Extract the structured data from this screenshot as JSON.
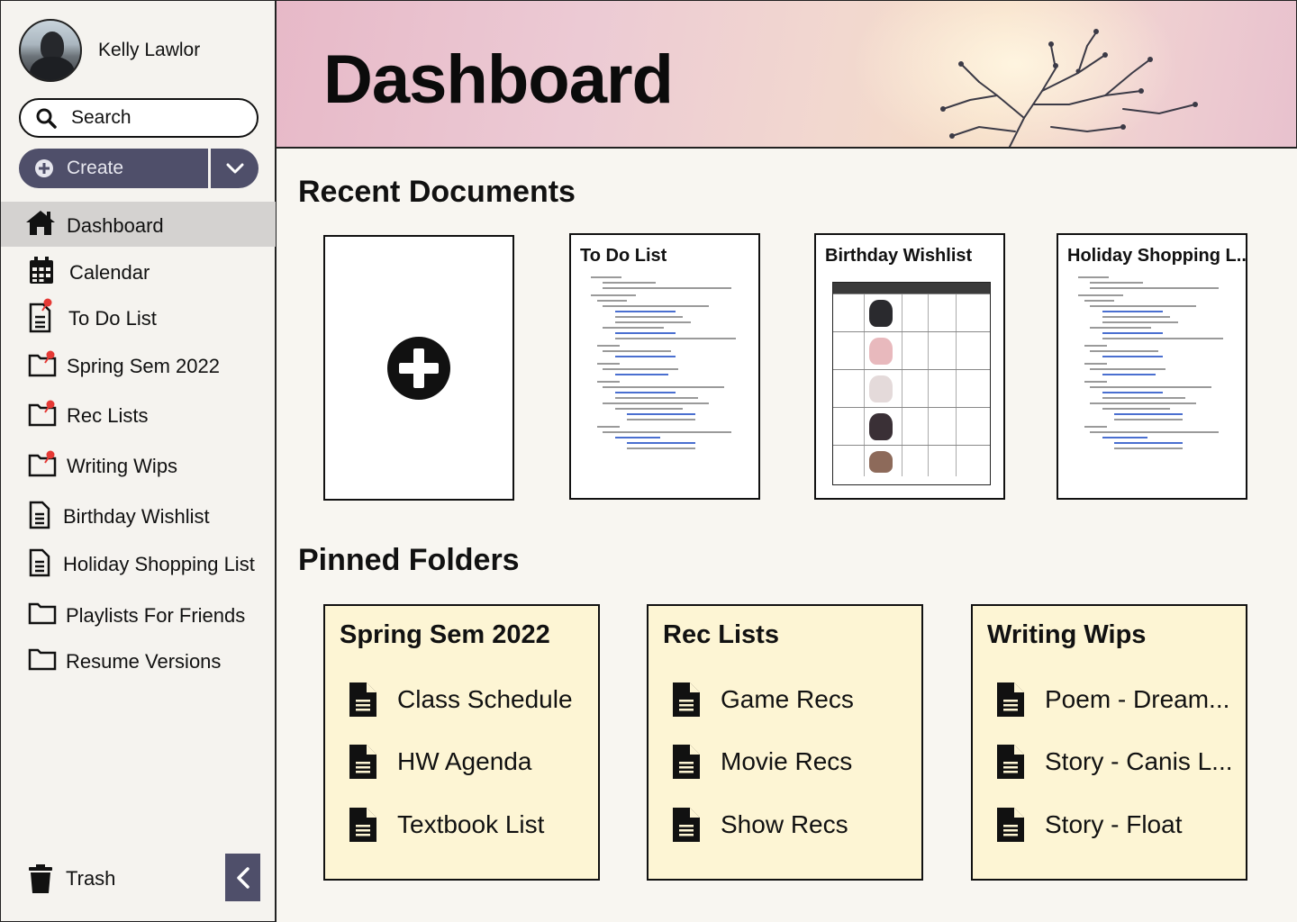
{
  "user": {
    "name": "Kelly Lawlor"
  },
  "search": {
    "label": "Search"
  },
  "create": {
    "label": "Create"
  },
  "sidebar": {
    "items": [
      {
        "label": "Dashboard",
        "icon": "home-icon",
        "active": true
      },
      {
        "label": "Calendar",
        "icon": "calendar-icon"
      },
      {
        "label": "To Do List",
        "icon": "pinned-document-icon"
      },
      {
        "label": "Spring Sem 2022",
        "icon": "pinned-folder-icon"
      },
      {
        "label": "Rec Lists",
        "icon": "pinned-folder-icon"
      },
      {
        "label": "Writing Wips",
        "icon": "pinned-folder-icon"
      },
      {
        "label": "Birthday Wishlist",
        "icon": "document-icon"
      },
      {
        "label": "Holiday Shopping List",
        "icon": "document-icon"
      },
      {
        "label": "Playlists For Friends",
        "icon": "folder-icon"
      },
      {
        "label": "Resume Versions",
        "icon": "folder-icon"
      }
    ],
    "trash": "Trash"
  },
  "header": {
    "title": "Dashboard"
  },
  "recent": {
    "title": "Recent Documents",
    "docs": [
      {
        "title": "To Do List"
      },
      {
        "title": "Birthday Wishlist"
      },
      {
        "title": "Holiday Shopping L.."
      }
    ]
  },
  "pinned": {
    "title": "Pinned Folders",
    "folders": [
      {
        "title": "Spring Sem 2022",
        "items": [
          "Class Schedule",
          "HW Agenda",
          "Textbook List"
        ]
      },
      {
        "title": "Rec Lists",
        "items": [
          "Game Recs",
          "Movie Recs",
          "Show Recs"
        ]
      },
      {
        "title": "Writing Wips",
        "items": [
          "Poem - Dream...",
          "Story - Canis L...",
          "Story - Float"
        ]
      }
    ]
  },
  "colors": {
    "accent": "#4f4f6a",
    "folder_bg": "#fdf5d4",
    "pin": "#e53935",
    "active_nav": "#d4d2d0"
  }
}
